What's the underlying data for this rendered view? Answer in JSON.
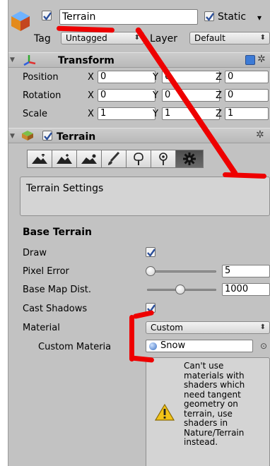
{
  "header": {
    "object_name": "Terrain",
    "static_label": "Static",
    "static_arrow": "▾",
    "tag_label": "Tag",
    "tag_value": "Untagged",
    "layer_label": "Layer",
    "layer_value": "Default",
    "dropdown_arrow": "⬍"
  },
  "transform": {
    "title": "Transform",
    "rows": [
      {
        "label": "Position",
        "x": "0",
        "y": "0",
        "z": "0"
      },
      {
        "label": "Rotation",
        "x": "0",
        "y": "0",
        "z": "0"
      },
      {
        "label": "Scale",
        "x": "1",
        "y": "1",
        "z": "1"
      }
    ],
    "axis_x": "X",
    "axis_y": "Y",
    "axis_z": "Z"
  },
  "terrain": {
    "title": "Terrain",
    "settings_text": "Terrain Settings",
    "base_terrain_title": "Base Terrain",
    "draw_label": "Draw",
    "pixel_error_label": "Pixel Error",
    "pixel_error_value": "5",
    "pixel_error_fraction": 0.0,
    "base_map_dist_label": "Base Map Dist.",
    "base_map_dist_value": "1000",
    "base_map_dist_fraction": 0.5,
    "cast_shadows_label": "Cast Shadows",
    "material_label": "Material",
    "material_value": "Custom",
    "custom_material_label": "Custom Materia",
    "custom_material_value": "Snow",
    "warning_text": "Can't use materials with shaders which need tangent geometry on terrain, use shaders in Nature/Terrain instead."
  },
  "colors": {
    "panel_bg": "#c2c2c2",
    "annotation_red": "#ee0000",
    "checkmark": "#2b4f9a",
    "warning_yellow": "#f2c318"
  }
}
